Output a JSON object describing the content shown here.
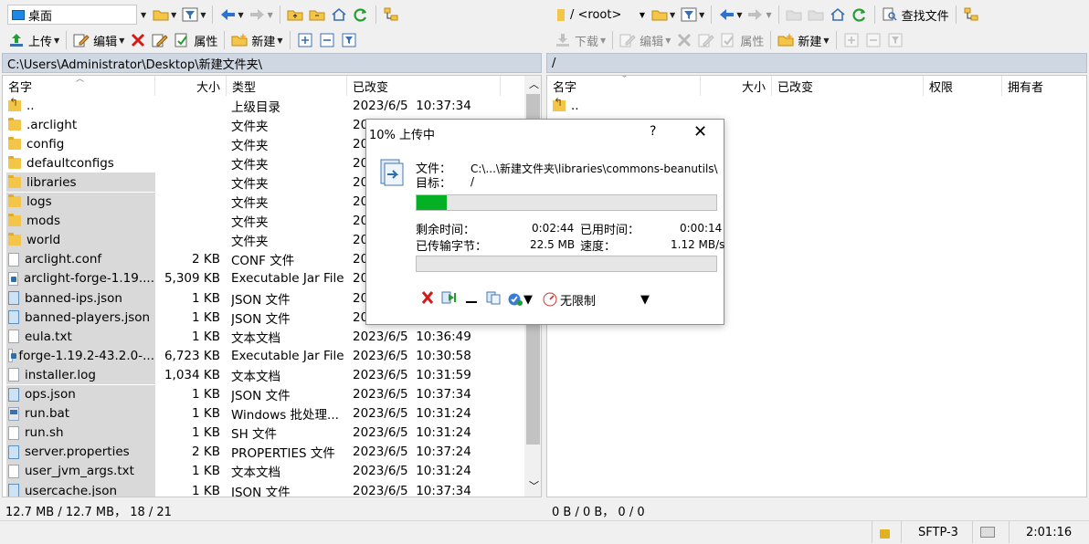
{
  "colors": {
    "path_bar": "#cfd7e2",
    "selection": "#d9d9d9",
    "progress": "#06b025",
    "accent": "#2c6ea8"
  },
  "left_toolbar1": {
    "location": "桌面"
  },
  "right_toolbar1": {
    "location": "/ <root>",
    "find_files": "查找文件"
  },
  "left_toolbar2": {
    "upload": "上传",
    "edit": "编辑",
    "properties": "属性",
    "new": "新建"
  },
  "right_toolbar2": {
    "download": "下载",
    "edit": "编辑",
    "properties": "属性",
    "new": "新建"
  },
  "left_path": "C:\\Users\\Administrator\\Desktop\\新建文件夹\\",
  "right_path": "/",
  "left_columns": {
    "name": "名字",
    "size": "大小",
    "type": "类型",
    "changed": "已改变"
  },
  "right_columns": {
    "name": "名字",
    "size": "大小",
    "changed": "已改变",
    "rights": "权限",
    "owner": "拥有者"
  },
  "left_files": [
    {
      "name": "..",
      "size": "",
      "type": "上级目录",
      "changed": "2023/6/5  10:37:34",
      "icon": "parent-dir"
    },
    {
      "name": ".arclight",
      "size": "",
      "type": "文件夹",
      "changed": "20",
      "icon": "folder"
    },
    {
      "name": "config",
      "size": "",
      "type": "文件夹",
      "changed": "20",
      "icon": "folder"
    },
    {
      "name": "defaultconfigs",
      "size": "",
      "type": "文件夹",
      "changed": "20",
      "icon": "folder"
    },
    {
      "name": "libraries",
      "size": "",
      "type": "文件夹",
      "changed": "20",
      "icon": "folder",
      "selected": true
    },
    {
      "name": "logs",
      "size": "",
      "type": "文件夹",
      "changed": "20",
      "icon": "folder",
      "selected": true
    },
    {
      "name": "mods",
      "size": "",
      "type": "文件夹",
      "changed": "20",
      "icon": "folder",
      "selected": true
    },
    {
      "name": "world",
      "size": "",
      "type": "文件夹",
      "changed": "20",
      "icon": "folder",
      "selected": true
    },
    {
      "name": "arclight.conf",
      "size": "2 KB",
      "type": "CONF 文件",
      "changed": "20",
      "icon": "file",
      "selected": true
    },
    {
      "name": "arclight-forge-1.19....",
      "size": "5,309 KB",
      "type": "Executable Jar File",
      "changed": "20",
      "icon": "jar",
      "selected": true
    },
    {
      "name": "banned-ips.json",
      "size": "1 KB",
      "type": "JSON 文件",
      "changed": "20",
      "icon": "json",
      "selected": true
    },
    {
      "name": "banned-players.json",
      "size": "1 KB",
      "type": "JSON 文件",
      "changed": "20",
      "icon": "json",
      "selected": true
    },
    {
      "name": "eula.txt",
      "size": "1 KB",
      "type": "文本文档",
      "changed": "2023/6/5  10:36:49",
      "icon": "file",
      "selected": true
    },
    {
      "name": "forge-1.19.2-43.2.0-...",
      "size": "6,723 KB",
      "type": "Executable Jar File",
      "changed": "2023/6/5  10:30:58",
      "icon": "jar",
      "selected": true
    },
    {
      "name": "installer.log",
      "size": "1,034 KB",
      "type": "文本文档",
      "changed": "2023/6/5  10:31:59",
      "icon": "file",
      "selected": true
    },
    {
      "name": "ops.json",
      "size": "1 KB",
      "type": "JSON 文件",
      "changed": "2023/6/5  10:37:34",
      "icon": "json",
      "selected": true
    },
    {
      "name": "run.bat",
      "size": "1 KB",
      "type": "Windows 批处理...",
      "changed": "2023/6/5  10:31:24",
      "icon": "bat",
      "selected": true
    },
    {
      "name": "run.sh",
      "size": "1 KB",
      "type": "SH 文件",
      "changed": "2023/6/5  10:31:24",
      "icon": "file",
      "selected": true
    },
    {
      "name": "server.properties",
      "size": "2 KB",
      "type": "PROPERTIES 文件",
      "changed": "2023/6/5  10:37:24",
      "icon": "json",
      "selected": true
    },
    {
      "name": "user_jvm_args.txt",
      "size": "1 KB",
      "type": "文本文档",
      "changed": "2023/6/5  10:31:24",
      "icon": "file",
      "selected": true
    },
    {
      "name": "usercache.json",
      "size": "1 KB",
      "type": "JSON 文件",
      "changed": "2023/6/5  10:37:34",
      "icon": "json",
      "selected": true
    }
  ],
  "right_files": [
    {
      "name": "..",
      "icon": "parent-dir"
    }
  ],
  "left_status": "12.7 MB / 12.7 MB，  18 / 21",
  "right_status": "0 B / 0 B，  0 / 0",
  "bottom_status": {
    "protocol": "SFTP-3",
    "elapsed": "2:01:16"
  },
  "dialog": {
    "title": "10% 上传中",
    "help": "?",
    "file_label": "文件：",
    "file_value": "C:\\...\\新建文件夹\\libraries\\commons-beanutils\\",
    "target_label": "目标：",
    "target_value": "/",
    "progress": 0.1,
    "remaining_label": "剩余时间：",
    "remaining_value": "0:02:44",
    "elapsed_label": "已用时间：",
    "elapsed_value": "0:00:14",
    "transferred_label": "已传输字节：",
    "transferred_value": "22.5 MB",
    "speed_label": "速度：",
    "speed_value": "1.12 MB/s",
    "overall_progress": 0,
    "speed_limit": "无限制"
  }
}
